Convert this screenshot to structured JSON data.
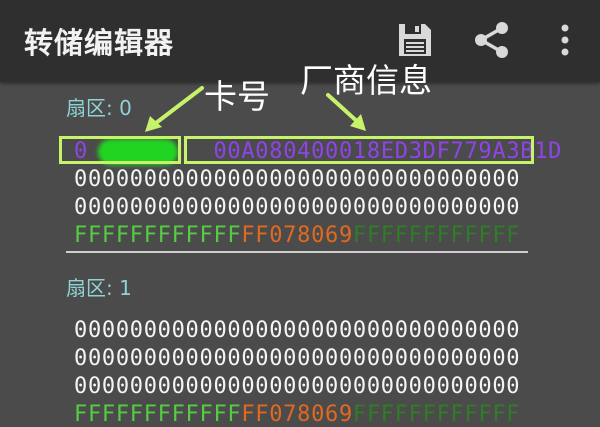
{
  "app": {
    "title": "转储编辑器"
  },
  "toolbar": {
    "save_icon": "save-icon",
    "share_icon": "share-icon",
    "more_icon": "more-vert-icon"
  },
  "annotations": {
    "card_number": "卡号",
    "vendor_info": "厂商信息",
    "color": "#c7f36b"
  },
  "sectors": [
    {
      "label": "扇区: 0",
      "rows": [
        {
          "uid_start": "0",
          "uid_end": "0",
          "vendor": "0A080400018ED3DF779A3B1D"
        },
        "00000000000000000000000000000000",
        "00000000000000000000000000000000",
        {
          "key_a": "FFFFFFFFFFFF",
          "access": "FF078069",
          "key_b": "FFFFFFFFFFFF"
        }
      ]
    },
    {
      "label": "扇区: 1",
      "rows": [
        "00000000000000000000000000000000",
        "00000000000000000000000000000000",
        "00000000000000000000000000000000",
        {
          "key_a": "FFFFFFFFFFFF",
          "access": "FF078069",
          "key_b": "FFFFFFFFFFFF"
        }
      ]
    }
  ],
  "colors": {
    "uid_vendor": "#8f45e6",
    "key_a": "#55cc44",
    "access_bits": "#e06a1f",
    "key_b": "#2f7d26",
    "sector_label": "#8fd3d7",
    "redaction": "#22d422"
  }
}
